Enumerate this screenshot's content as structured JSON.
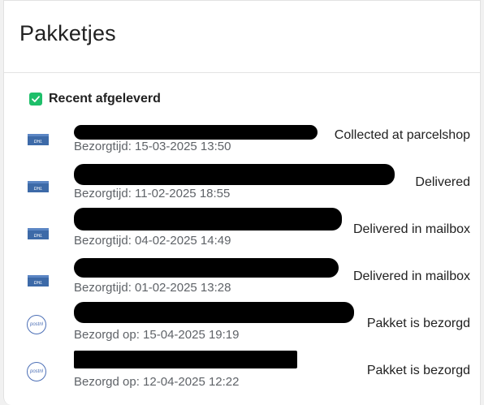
{
  "card": {
    "title": "Pakketjes",
    "section_label": "Recent afgeleverd"
  },
  "parcels": [
    {
      "carrier_icon": "dhl-logo-icon",
      "meta": "Bezorgtijd: 15-03-2025 13:50",
      "status": "Collected at parcelshop"
    },
    {
      "carrier_icon": "dhl-logo-icon",
      "meta": "Bezorgtijd: 11-02-2025 18:55",
      "status": "Delivered"
    },
    {
      "carrier_icon": "dhl-logo-icon",
      "meta": "Bezorgtijd: 04-02-2025 14:49",
      "status": "Delivered in mailbox"
    },
    {
      "carrier_icon": "dhl-logo-icon",
      "meta": "Bezorgtijd: 01-02-2025 13:28",
      "status": "Delivered in mailbox"
    },
    {
      "carrier_icon": "postnl-logo-icon",
      "meta": "Bezorgd op: 15-04-2025 19:19",
      "status": "Pakket is bezorgd"
    },
    {
      "carrier_icon": "postnl-logo-icon",
      "meta": "Bezorgd op: 12-04-2025 12:22",
      "status": "Pakket is bezorgd"
    }
  ],
  "colors": {
    "check_green": "#1ebf6a",
    "dhl_blue": "#3d6aa8",
    "postnl_blue": "#4c6fb6"
  }
}
